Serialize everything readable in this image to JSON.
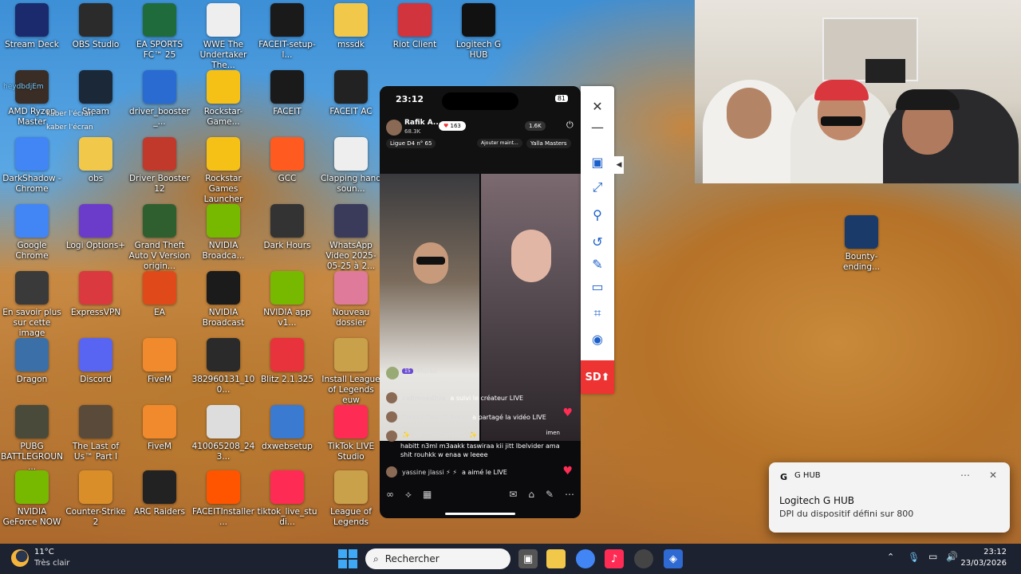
{
  "desktop_icons": [
    {
      "label": "Stream Deck",
      "color": "#1a2a6c"
    },
    {
      "label": "OBS Studio",
      "color": "#2b2b2b"
    },
    {
      "label": "EA SPORTS FC™ 25",
      "color": "#1f6b3b"
    },
    {
      "label": "WWE The Undertaker The...",
      "color": "#eeeeee"
    },
    {
      "label": "FACEIT-setup-l...",
      "color": "#1a1a1a"
    },
    {
      "label": "mssdk",
      "color": "#f2c84b"
    },
    {
      "label": "Riot Client",
      "color": "#d1343c"
    },
    {
      "label": "Logitech G HUB",
      "color": "#111111"
    },
    {
      "label": "AMD Ryzen Master",
      "color": "#3a2d25"
    },
    {
      "label": "Steam",
      "color": "#1b2838"
    },
    {
      "label": "driver_booster_...",
      "color": "#2a6bd1"
    },
    {
      "label": "Rockstar-Game...",
      "color": "#f6c117"
    },
    {
      "label": "FACEIT",
      "color": "#1a1a1a"
    },
    {
      "label": "FACEIT AC",
      "color": "#222222"
    },
    {
      "label": "DarkShadow - Chrome",
      "color": "#4285f4"
    },
    {
      "label": "obs",
      "color": "#f2c84b"
    },
    {
      "label": "Driver Booster 12",
      "color": "#c0392b"
    },
    {
      "label": "Rockstar Games Launcher",
      "color": "#f6c117"
    },
    {
      "label": "GCC",
      "color": "#ff5a1f"
    },
    {
      "label": "Clapping hand soun...",
      "color": "#eeeeee"
    },
    {
      "label": "Google Chrome",
      "color": "#4285f4"
    },
    {
      "label": "Logi Options+",
      "color": "#6b3cc9"
    },
    {
      "label": "Grand Theft Auto V Version origin...",
      "color": "#2f5f2f"
    },
    {
      "label": "NVIDIA Broadca...",
      "color": "#76b900"
    },
    {
      "label": "Dark Hours",
      "color": "#333333"
    },
    {
      "label": "WhatsApp Video 2025-05-25 à 2...",
      "color": "#3a3a5a"
    },
    {
      "label": "En savoir plus sur cette image",
      "color": "#3a3a3a"
    },
    {
      "label": "ExpressVPN",
      "color": "#da3940"
    },
    {
      "label": "EA",
      "color": "#e04a1b"
    },
    {
      "label": "NVIDIA Broadcast",
      "color": "#1b1b1b"
    },
    {
      "label": "NVIDIA app v1...",
      "color": "#76b900"
    },
    {
      "label": "Nouveau dossier",
      "color": "#e07a9a"
    },
    {
      "label": "Dragon",
      "color": "#3a6fa8"
    },
    {
      "label": "Discord",
      "color": "#5865f2"
    },
    {
      "label": "FiveM",
      "color": "#f08a2c"
    },
    {
      "label": "382960131_100...",
      "color": "#2a2a2a"
    },
    {
      "label": "Blitz 2.1.325",
      "color": "#e8323c"
    },
    {
      "label": "Install League of Legends euw",
      "color": "#c8a14a"
    },
    {
      "label": "PUBG BATTLEGROUN...",
      "color": "#4a4a3a"
    },
    {
      "label": "The Last of Us™ Part I",
      "color": "#5a4a3a"
    },
    {
      "label": "FiveM",
      "color": "#f08a2c"
    },
    {
      "label": "410065208_243...",
      "color": "#ddd"
    },
    {
      "label": "dxwebsetup",
      "color": "#3a7ad1"
    },
    {
      "label": "TikTok LIVE Studio",
      "color": "#fe2c55"
    },
    {
      "label": "NVIDIA GeForce NOW",
      "color": "#76b900"
    },
    {
      "label": "Counter-Strike 2",
      "color": "#d98e2a"
    },
    {
      "label": "ARC Raiders",
      "color": "#222222"
    },
    {
      "label": "FACEITInstaller...",
      "color": "#ff5500"
    },
    {
      "label": "tiktok_live_studi...",
      "color": "#fe2c55"
    },
    {
      "label": "League of Legends",
      "color": "#c8a14a"
    },
    {
      "label": "Bounty-ending...",
      "color": "#1a3a6a"
    }
  ],
  "overlay_lines": [
    "heydbdjEm",
    "kaber l'écran",
    "kaber l'écran"
  ],
  "phone": {
    "time": "23:12",
    "battery": "81",
    "host_name": "Rafik A...",
    "host_likes": "68.3K",
    "gift_count": "163",
    "viewers": "1.6K",
    "league": "Ligue D4 n° 65",
    "add_btn": "Ajouter maint...",
    "masters": "Yalla Masters",
    "right_guest": "imen",
    "comments": [
      {
        "name": "Murad",
        "text": "·"
      },
      {
        "name": "callmeedhia",
        "text": "a suivi le créateur LIVE"
      },
      {
        "name": "Yousfi Yousfi Amal",
        "text": "a partagé la vidéo LIVE"
      },
      {
        "name": "✨_yamnouchaaaaa_✨",
        "text": "habitt n3ml m3aakk taswiraa kii jitt lbelvider ama shit rouhkk w enaa w leeee"
      },
      {
        "name": "yassine jlassi ⚡ ⚡",
        "text": "a aimé le LIVE"
      }
    ],
    "level_badge": "15"
  },
  "toolbar": {
    "sd_label": "SD"
  },
  "toast": {
    "app": "G HUB",
    "title": "Logitech G HUB",
    "body": "DPI du dispositif défini sur 800"
  },
  "taskbar": {
    "temp": "11°C",
    "weather": "Très clair",
    "search_placeholder": "Rechercher",
    "time": "23:12",
    "date": "23/03/2026"
  }
}
